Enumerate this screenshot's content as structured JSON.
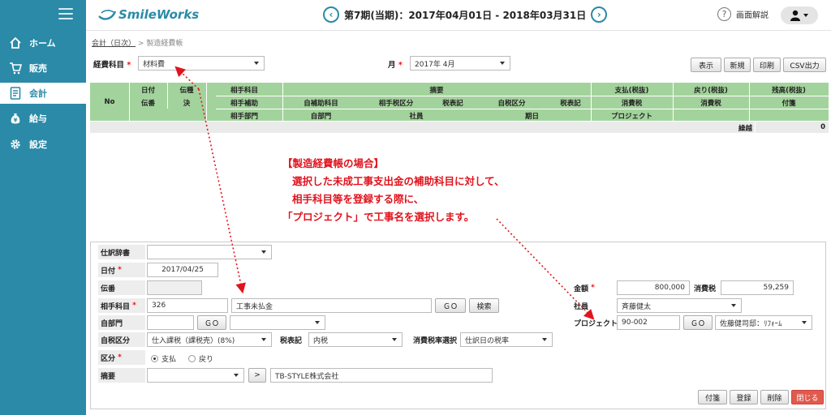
{
  "app": {
    "logo_text": "SmileWorks"
  },
  "sidebar": {
    "items": [
      {
        "label": "ホーム",
        "icon": "home-icon"
      },
      {
        "label": "販売",
        "icon": "cart-icon"
      },
      {
        "label": "会計",
        "icon": "ledger-icon",
        "active": true
      },
      {
        "label": "給与",
        "icon": "money-bag-icon"
      },
      {
        "label": "設定",
        "icon": "gear-icon"
      }
    ]
  },
  "header": {
    "period": "第7期(当期)：2017年04月01日 - 2018年03月31日",
    "help_label": "画面解説"
  },
  "breadcrumb": {
    "parent": "会計（日次）",
    "separator": ">",
    "current": "製造経費帳"
  },
  "filters": {
    "account_label": "経費科目",
    "account_value": "材料費",
    "month_label": "月",
    "month_value": "2017年 4月",
    "required_mark": "*"
  },
  "toolbar": {
    "show": "表示",
    "new": "新規",
    "print": "印刷",
    "csv": "CSV出力"
  },
  "table": {
    "headers": {
      "no": "No",
      "date": "日付",
      "slip": "伝番",
      "kind": "伝種",
      "kind2": "決",
      "counter_account": "相手科目",
      "counter_sub": "相手補助",
      "counter_dept": "相手部門",
      "summary": "摘要",
      "self_sub": "自補助科目",
      "counter_tax_class": "相手税区分",
      "tax_note1": "税表記",
      "self_tax_class": "自税区分",
      "tax_note2": "税表記",
      "self_dept": "自部門",
      "employee": "社員",
      "due": "期日",
      "payment": "支払(税抜)",
      "consumption_tax1": "消費税",
      "project": "プロジェクト",
      "refund": "戻り(税抜)",
      "consumption_tax2": "消費税",
      "balance": "残高(税抜)",
      "memo": "付箋"
    },
    "carry_label": "繰越",
    "carry_value": "0"
  },
  "annotation": {
    "line1": "【製造経費帳の場合】",
    "line2": "選択した未成工事支出金の補助科目に対して、",
    "line3": "相手科目等を登録する際に、",
    "line4": "「プロジェクト」で工事名を選択します。"
  },
  "entry": {
    "dictionary_label": "仕訳辞書",
    "dictionary_value": "",
    "date_label": "日付",
    "date_value": "2017/04/25",
    "slip_label": "伝番",
    "slip_value": "",
    "counter_account_label": "相手科目",
    "counter_account_code": "326",
    "counter_account_name": "工事未払金",
    "go_label": "ＧＯ",
    "search_label": "検索",
    "self_dept_label": "自部門",
    "self_dept_code": "",
    "self_dept_value": "",
    "tax_class_label": "自税区分",
    "tax_class_value": "仕入課税（課税売）(8%)",
    "tax_note_label": "税表記",
    "tax_note_value": "内税",
    "tax_rate_label": "消費税率選択",
    "tax_rate_value": "仕訳日の税率",
    "division_label": "区分",
    "division_pay": "支払",
    "division_return": "戻り",
    "summary_label": "摘要",
    "summary_select": "",
    "summary_arrow": ">",
    "summary_value": "TB-STYLE株式会社",
    "amount_label": "金額",
    "amount_value": "800,000",
    "ctax_label": "消費税",
    "ctax_value": "59,259",
    "employee_label": "社員",
    "employee_value": "斉藤健太",
    "project_label": "プロジェクト",
    "project_code": "90-002",
    "project_name": "佐藤健司邸：ﾘﾌｫｰﾑ"
  },
  "footer_buttons": {
    "memo": "付箋",
    "register": "登録",
    "delete": "削除",
    "close": "閉じる"
  },
  "colors": {
    "sidebar": "#2a8aa8",
    "table_header": "#a3d39c",
    "annotation": "#e0141e",
    "close_button": "#e05a4e"
  }
}
